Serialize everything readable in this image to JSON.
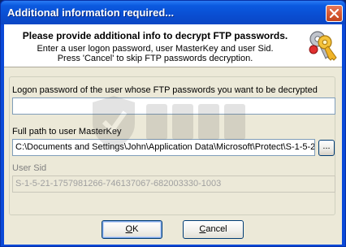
{
  "window": {
    "title": "Additional information required..."
  },
  "header": {
    "title": "Please provide additional info to decrypt FTP passwords.",
    "line1": "Enter a user logon password, user MasterKey and user Sid.",
    "line2": "Press 'Cancel' to skip FTP passwords decryption.",
    "icon": "keys-icon"
  },
  "form": {
    "password_label": "Logon password of the user whose FTP passwords you want to be decrypted",
    "password_value": "",
    "masterkey_label": "Full path to user MasterKey",
    "masterkey_value": "C:\\Documents and Settings\\John\\Application Data\\Microsoft\\Protect\\S-1-5-2",
    "browse_label": "...",
    "sid_label": "User Sid",
    "sid_value": "S-1-5-21-1757981266-746137067-682003330-1003"
  },
  "buttons": {
    "ok_mnemonic": "O",
    "ok_rest": "K",
    "cancel_mnemonic": "C",
    "cancel_rest": "ancel"
  },
  "colors": {
    "title_bar": "#0a4ed2",
    "dialog_bg": "#ece9d8",
    "close_button": "#d65a33"
  }
}
